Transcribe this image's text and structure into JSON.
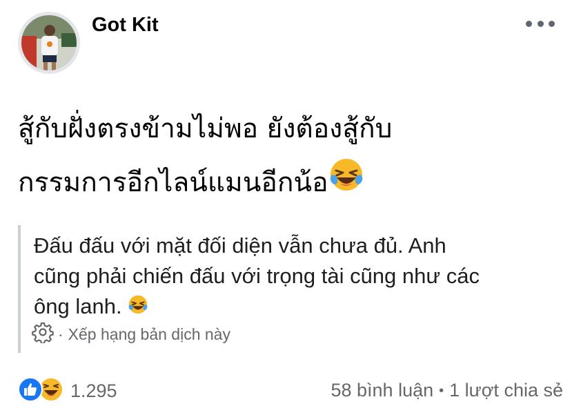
{
  "post": {
    "author": "Got Kit",
    "text_lines": [
      "สู้กับฝั่งตรงข้ามไม่พอ ยังต้องสู้กับ",
      "กรรมการอีกไลน์แมนอีกน้อ"
    ],
    "translation_lines": [
      "Đấu đấu với mặt đối diện vẫn chưa đủ. Anh",
      "cũng phải chiến đấu với trọng tài cũng như các",
      "ông lanh."
    ],
    "rate_separator": "·",
    "rate_label": "Xếp hạng bản dịch này"
  },
  "footer": {
    "reaction_count": "1.295",
    "comments": "58 bình luận",
    "separator": "•",
    "shares": "1 lượt chia sẻ"
  },
  "icons": {
    "more": "more-options-icon",
    "emoji": "rolling-laughing-emoji",
    "settings": "gear-icon",
    "like": "like-reaction-icon",
    "haha": "haha-reaction-icon"
  },
  "colors": {
    "like_blue": "#1877f2",
    "emoji_yellow": "#f7b928",
    "secondary_text": "#65676b"
  }
}
